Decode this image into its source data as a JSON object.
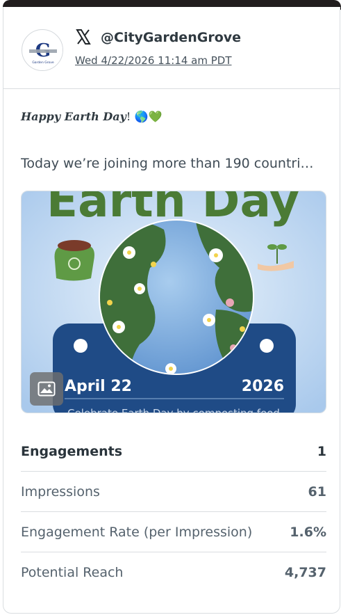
{
  "post": {
    "handle": "@CityGardenGrove",
    "timestamp": "Wed 4/22/2026 11:14 am PDT",
    "greeting_italic": "Happy Earth Day",
    "greeting_bang": "!",
    "greeting_emoji": "🌎💚",
    "body_text": "Today we’re joining more than 190 countri…",
    "avatar_logo_text": "Garden Grove",
    "network_icon": "x-logo-icon",
    "media_badge_icon": "image-icon"
  },
  "media_image": {
    "headline": "Earth Day",
    "date_left": "April 22",
    "date_right": "2026",
    "caption": "Celebrate Earth Day by composting food"
  },
  "stats": [
    {
      "label": "Engagements",
      "value": "1"
    },
    {
      "label": "Impressions",
      "value": "61"
    },
    {
      "label": "Engagement Rate (per Impression)",
      "value": "1.6%"
    },
    {
      "label": "Potential Reach",
      "value": "4,737"
    }
  ],
  "colors": {
    "top_bar": "#211d1e",
    "divider": "#d9dde0",
    "text_primary": "#2a343b",
    "text_secondary": "#55626d",
    "poster_green": "#4b7b35",
    "poster_navy": "#1f4b86"
  }
}
